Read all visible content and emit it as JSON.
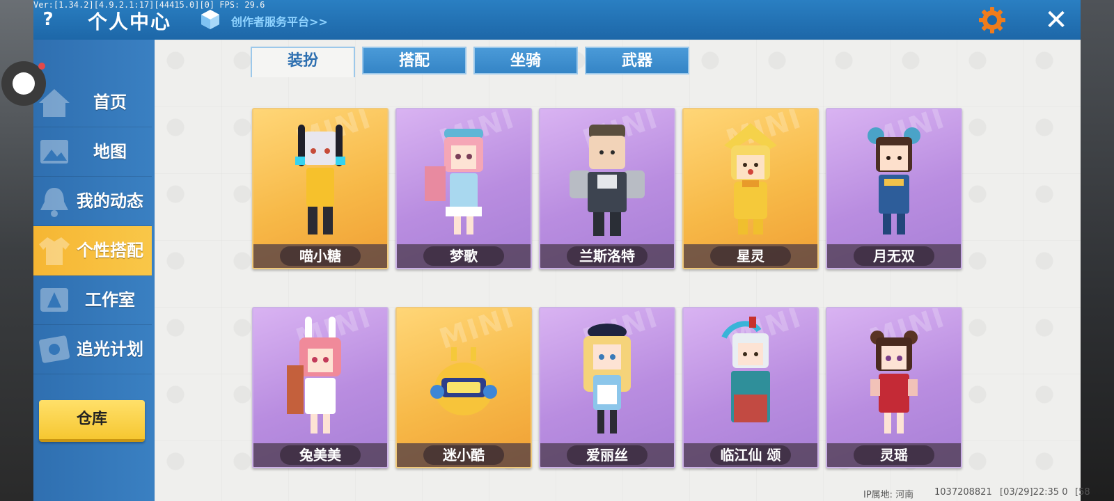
{
  "debug": {
    "text": "Ver:[1.34.2][4.9.2.1:17][44415.0][0] FPS: 29.6"
  },
  "header": {
    "help_glyph": "?",
    "title": "个人中心",
    "creator_link": "创作者服务平台>>",
    "close_glyph": "✕",
    "accent": "#1d67a8"
  },
  "sidebar": {
    "items": [
      {
        "label": "首页",
        "icon": "home-icon"
      },
      {
        "label": "地图",
        "icon": "map-icon"
      },
      {
        "label": "我的动态",
        "icon": "bell-icon"
      },
      {
        "label": "个性搭配",
        "icon": "wardrobe-icon",
        "active": true
      },
      {
        "label": "工作室",
        "icon": "studio-icon"
      },
      {
        "label": "追光计划",
        "icon": "plan-icon"
      }
    ],
    "warehouse_label": "仓库"
  },
  "tabs": [
    {
      "label": "装扮",
      "active": true
    },
    {
      "label": "搭配",
      "active": false
    },
    {
      "label": "坐骑",
      "active": false
    },
    {
      "label": "武器",
      "active": false
    }
  ],
  "skins": [
    {
      "name": "喵小糖",
      "tier": "gold"
    },
    {
      "name": "梦歌",
      "tier": "purple"
    },
    {
      "name": "兰斯洛特",
      "tier": "purple"
    },
    {
      "name": "星灵",
      "tier": "gold"
    },
    {
      "name": "月无双",
      "tier": "purple"
    },
    {
      "name": "兔美美",
      "tier": "purple"
    },
    {
      "name": "迷小酷",
      "tier": "gold"
    },
    {
      "name": "爱丽丝",
      "tier": "purple"
    },
    {
      "name": "临江仙 颂",
      "tier": "purple"
    },
    {
      "name": "灵瑶",
      "tier": "purple"
    }
  ],
  "card_watermark": "MINI",
  "footer": {
    "ip_location": "IP属地: 河南",
    "user_id": "1037208821",
    "timestamp": "[03/29]22:35 0",
    "extra": "[58"
  },
  "colors": {
    "gold_card": "#f7b948",
    "purple_card": "#b98de0",
    "active_nav": "#f6b633",
    "warehouse": "#f6c731"
  }
}
